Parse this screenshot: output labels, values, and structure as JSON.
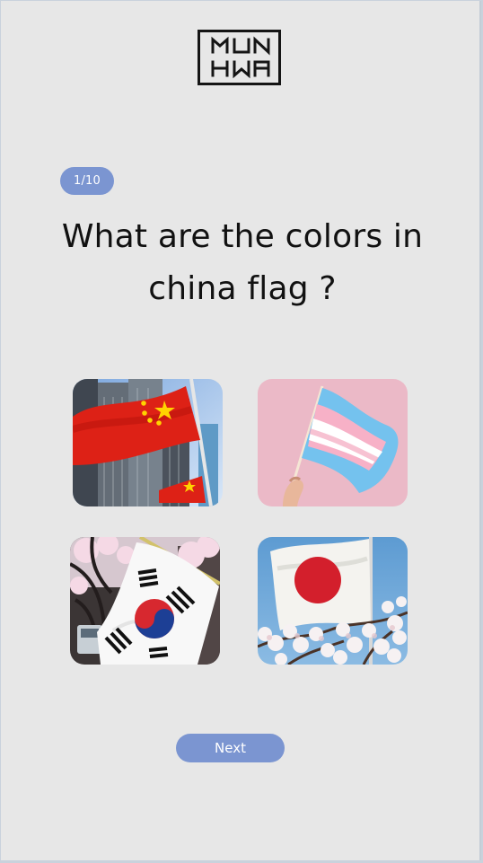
{
  "logo": {
    "text": "MUN HWA",
    "line1": "MUN",
    "line2": "HWA",
    "icon": "munhwa-logo"
  },
  "quiz": {
    "progress": "1/10",
    "question": "What are the colors in china flag ?"
  },
  "options": [
    {
      "icon": "china-flag-image"
    },
    {
      "icon": "transgender-flag-image"
    },
    {
      "icon": "south-korea-flag-image"
    },
    {
      "icon": "japan-flag-image"
    }
  ],
  "actions": {
    "next_label": "Next"
  },
  "colors": {
    "background": "#e7e7e7",
    "accent": "#7b95d1",
    "text": "#111111"
  }
}
